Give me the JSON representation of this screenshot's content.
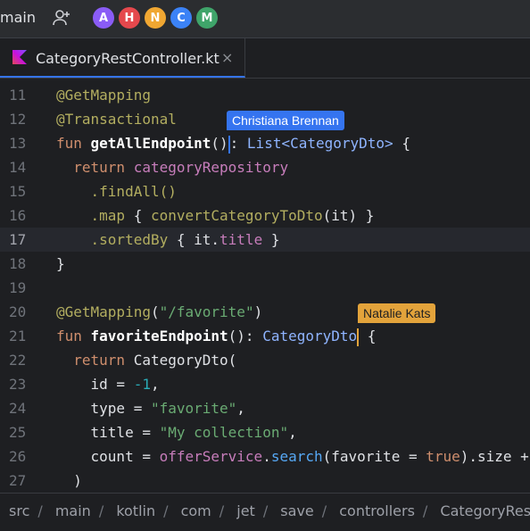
{
  "header": {
    "branch": "main",
    "avatars": [
      {
        "initial": "A",
        "color": "#8a5cf6"
      },
      {
        "initial": "H",
        "color": "#e5484d"
      },
      {
        "initial": "N",
        "color": "#f0a732"
      },
      {
        "initial": "C",
        "color": "#3b82f6"
      },
      {
        "initial": "M",
        "color": "#3fa46a"
      }
    ]
  },
  "tab": {
    "filename": "CategoryRestController.kt",
    "close": "×"
  },
  "collaborators": {
    "cursor1": {
      "name": "Christiana Brennan",
      "color": "#3574f0"
    },
    "cursor2": {
      "name": "Natalie Kats",
      "color": "#e3a33b"
    }
  },
  "editor": {
    "line_numbers": [
      "11",
      "12",
      "13",
      "14",
      "15",
      "16",
      "17",
      "18",
      "19",
      "20",
      "21",
      "22",
      "23",
      "24",
      "25",
      "26",
      "27"
    ],
    "current_line": "17",
    "l11": {
      "a": "@GetMapping"
    },
    "l12": {
      "a": "@Transactional"
    },
    "l13": {
      "kw": "fun ",
      "fn": "getAllEndpoint",
      "p": "()",
      "c": ": ",
      "t": "List<CategoryDto>",
      "b": " {"
    },
    "l14": {
      "kw": "return ",
      "v": "categoryRepository"
    },
    "l15": {
      "v": ".findAll()"
    },
    "l16": {
      "m": ".map",
      "a": " { ",
      "f": "convertCategoryToDto",
      "b": "(it) }"
    },
    "l17": {
      "m": ".sortedBy",
      "a": " { it.",
      "p": "title",
      "b": " }"
    },
    "l18": {
      "v": "}"
    },
    "l20": {
      "a": "@GetMapping",
      "p": "(",
      "s": "\"/favorite\"",
      "c": ")"
    },
    "l21": {
      "kw": "fun ",
      "fn": "favoriteEndpoint",
      "p": "(): ",
      "t": "CategoryDto",
      "b": " {"
    },
    "l22": {
      "kw": "return ",
      "v": "CategoryDto("
    },
    "l23": {
      "a": "id = ",
      "n": "-1",
      "b": ","
    },
    "l24": {
      "a": "type = ",
      "s": "\"favorite\"",
      "b": ","
    },
    "l25": {
      "a": "title = ",
      "s": "\"My collection\"",
      "b": ","
    },
    "l26": {
      "a": "count = ",
      "f": "offerService",
      "d": ".",
      "g": "search",
      "h": "(favorite = ",
      "k": "true",
      "e": ").size +"
    },
    "l27": {
      "v": ")"
    }
  },
  "breadcrumbs": [
    "src",
    "main",
    "kotlin",
    "com",
    "jet",
    "save",
    "controllers",
    "CategoryRestControl"
  ]
}
